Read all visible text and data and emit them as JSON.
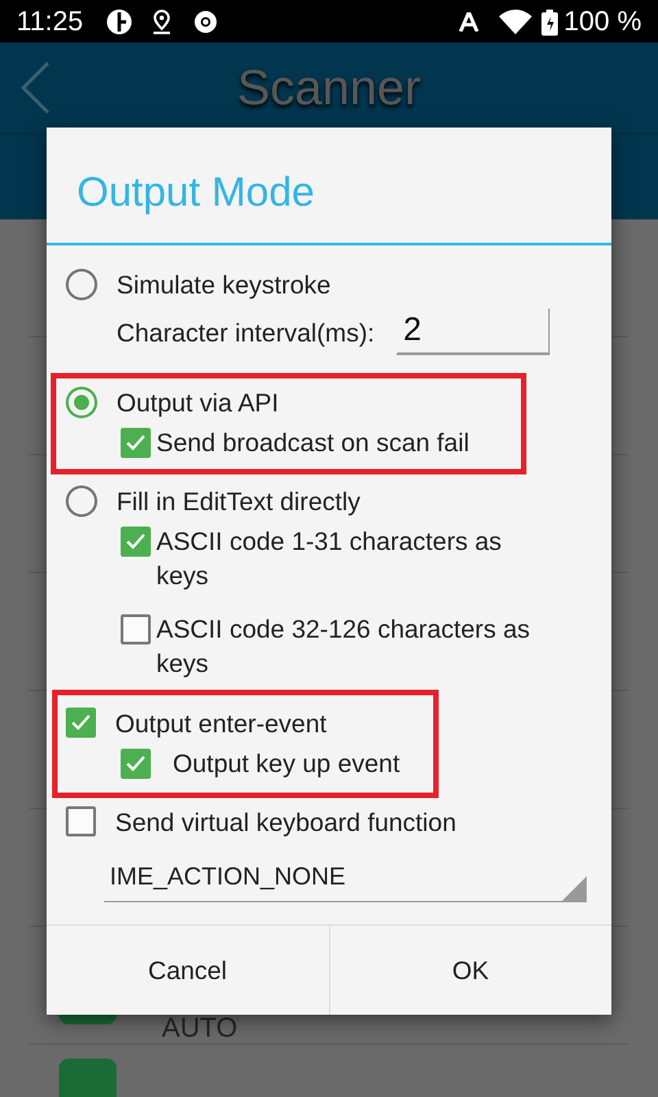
{
  "status_bar": {
    "time": "11:25",
    "battery": "100 %"
  },
  "app_bar": {
    "title": "Scanner"
  },
  "background_list": {
    "items": [
      {
        "label": "AUTO"
      }
    ]
  },
  "dialog": {
    "title": "Output Mode",
    "groups": [
      {
        "highlighted": false,
        "items": [
          {
            "kind": "radio",
            "label": "Simulate keystroke",
            "selected": false
          },
          {
            "kind": "field",
            "label": "Character interval(ms):",
            "value": "2"
          }
        ]
      },
      {
        "highlighted": true,
        "items": [
          {
            "kind": "radio",
            "label": "Output via API",
            "selected": true
          },
          {
            "kind": "subcheck",
            "label": "Send broadcast on scan fail",
            "checked": true
          }
        ]
      },
      {
        "highlighted": false,
        "items": [
          {
            "kind": "radio",
            "label": "Fill in EditText directly",
            "selected": false
          },
          {
            "kind": "subcheck",
            "label": "ASCII code 1-31 characters as keys",
            "checked": true
          },
          {
            "kind": "subcheck",
            "label": "ASCII code 32-126 characters as keys",
            "checked": false
          }
        ]
      },
      {
        "highlighted": true,
        "items": [
          {
            "kind": "check",
            "label": "Output enter-event",
            "checked": true
          },
          {
            "kind": "subcheck",
            "label": "Output key up event",
            "checked": true
          }
        ]
      },
      {
        "highlighted": false,
        "items": [
          {
            "kind": "check",
            "label": "Send virtual keyboard function",
            "checked": false
          },
          {
            "kind": "dropdown",
            "value": "IME_ACTION_NONE"
          }
        ]
      }
    ],
    "buttons": [
      "Cancel",
      "OK"
    ]
  }
}
